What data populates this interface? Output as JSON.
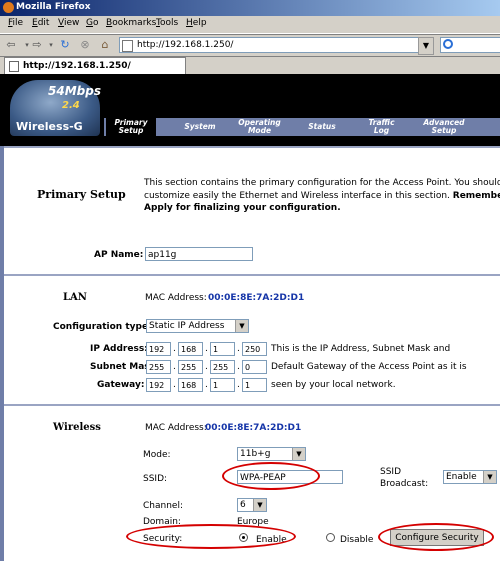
{
  "window": {
    "title": "Mozilla Firefox"
  },
  "menu": [
    {
      "label": "File",
      "key": "F",
      "rest": "ile"
    },
    {
      "label": "Edit",
      "key": "E",
      "rest": "dit"
    },
    {
      "label": "View",
      "key": "V",
      "rest": "iew"
    },
    {
      "label": "Go",
      "key": "G",
      "rest": "o"
    },
    {
      "label": "Bookmarks",
      "key": "B",
      "rest": "ookmarks"
    },
    {
      "label": "Tools",
      "key": "T",
      "rest": "ools"
    },
    {
      "label": "Help",
      "key": "H",
      "rest": "elp"
    }
  ],
  "address": {
    "url": "http://192.168.1.250/"
  },
  "tab": {
    "title": "http://192.168.1.250/"
  },
  "logo": {
    "speed": "54Mbps",
    "band": "2.4",
    "name": "Wireless-G"
  },
  "nav_tabs": [
    {
      "line1": "Primary",
      "line2": "Setup",
      "active": true
    },
    {
      "line1": "System",
      "line2": "",
      "active": false
    },
    {
      "line1": "Operating",
      "line2": "Mode",
      "active": false
    },
    {
      "line1": "Status",
      "line2": "",
      "active": false
    },
    {
      "line1": "Traffic",
      "line2": "Log",
      "active": false
    },
    {
      "line1": "Advanced",
      "line2": "Setup",
      "active": false
    },
    {
      "line1": "",
      "line2": "",
      "active": false
    }
  ],
  "primary": {
    "title": "Primary Setup",
    "desc1": "This section contains the primary configuration for the Access Point. You should be",
    "desc2a": "customize easily the Ethernet and Wireless interface in this section.",
    "desc2b": "Remember t",
    "desc3": "Apply for finalizing your configuration."
  },
  "ap": {
    "label": "AP Name:",
    "value": "ap11g"
  },
  "lan": {
    "title": "LAN",
    "mac_label": "MAC Address:",
    "mac": "00:0E:8E:7A:2D:D1",
    "config_label": "Configuration type:",
    "config_value": "Static IP Address",
    "ip_label": "IP Address:",
    "ip": [
      "192",
      "168",
      "1",
      "250"
    ],
    "ip_note": "This is the IP Address, Subnet Mask and",
    "mask_label": "Subnet Mask:",
    "mask": [
      "255",
      "255",
      "255",
      "0"
    ],
    "mask_note": "Default Gateway of the Access Point as it is",
    "gw_label": "Gateway:",
    "gw": [
      "192",
      "168",
      "1",
      "1"
    ],
    "gw_note": "seen by your local network."
  },
  "wireless": {
    "title": "Wireless",
    "mac_label": "MAC Address:",
    "mac": "00:0E:8E:7A:2D:D1",
    "mode_label": "Mode:",
    "mode_value": "11b+g",
    "ssid_label": "SSID:",
    "ssid_value": "WPA-PEAP",
    "broadcast_label1": "SSID",
    "broadcast_label2": "Broadcast:",
    "broadcast_value": "Enable",
    "channel_label": "Channel:",
    "channel_value": "6",
    "domain_label": "Domain:",
    "domain_value": "Europe",
    "security_label": "Security:",
    "enable_label": "Enable",
    "disable_label": "Disable",
    "configure_button": "Configure Security"
  },
  "colors": {
    "highlight": "#d40000",
    "mac_blue": "#1535a8",
    "nav_bar": "#6f7ea8"
  }
}
